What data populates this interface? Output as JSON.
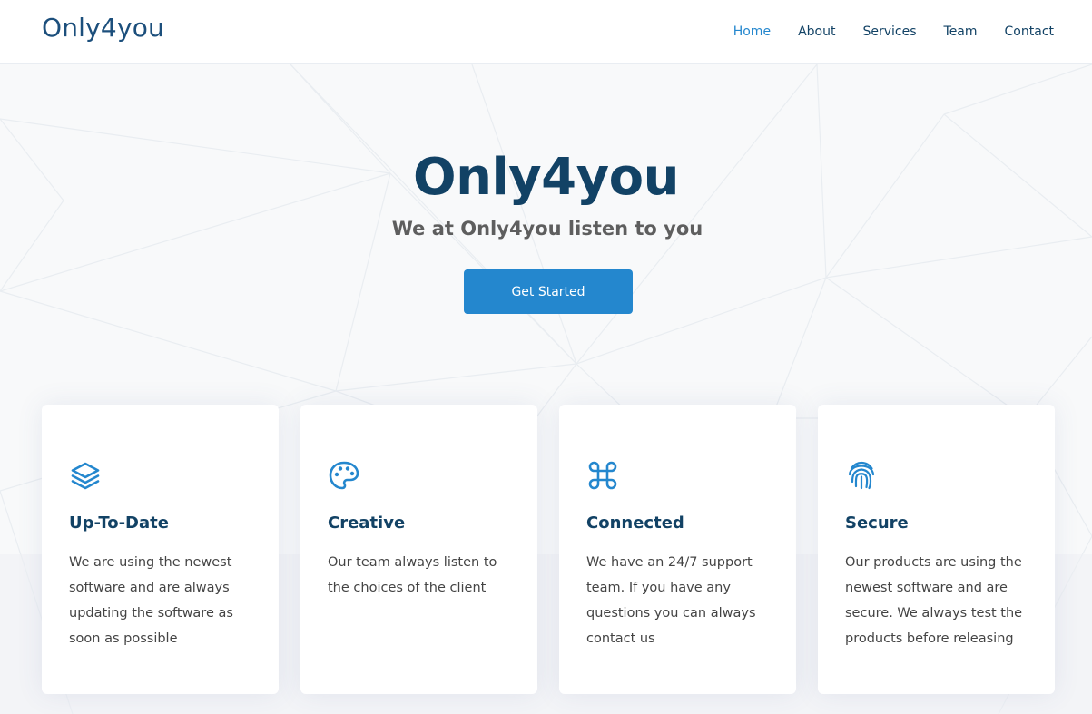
{
  "header": {
    "logo": "Only4you",
    "nav": [
      {
        "label": "Home",
        "active": true
      },
      {
        "label": "About",
        "active": false
      },
      {
        "label": "Services",
        "active": false
      },
      {
        "label": "Team",
        "active": false
      },
      {
        "label": "Contact",
        "active": false
      }
    ]
  },
  "hero": {
    "title": "Only4you",
    "subtitle": "We at Only4you listen to you",
    "cta_label": "Get Started"
  },
  "features": [
    {
      "icon": "layers-icon",
      "title": "Up-To-Date",
      "description": "We are using the newest software and are always updating the software as soon as possible"
    },
    {
      "icon": "palette-icon",
      "title": "Creative",
      "description": "Our team always listen to the choices of the client"
    },
    {
      "icon": "command-icon",
      "title": "Connected",
      "description": "We have an 24/7 support team. If you have any questions you can always contact us"
    },
    {
      "icon": "fingerprint-icon",
      "title": "Secure",
      "description": "Our products are using the newest software and are secure. We always test the products before releasing"
    }
  ],
  "colors": {
    "accent": "#2487ce",
    "heading": "#124265",
    "text": "#444444",
    "hero_bg": "#f8f9fa"
  }
}
